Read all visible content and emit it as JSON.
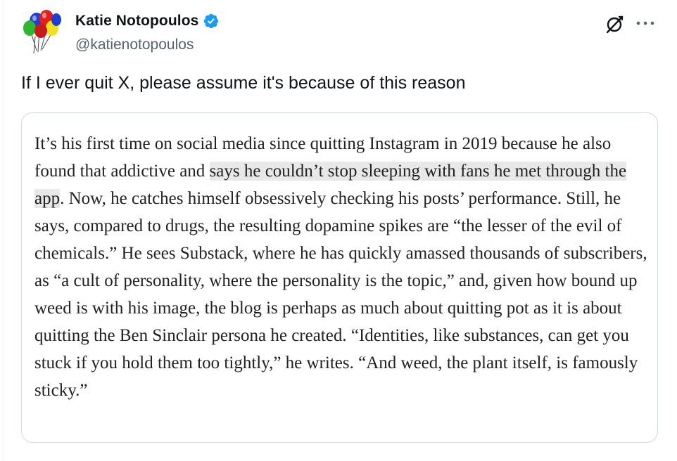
{
  "tweet": {
    "author": {
      "display_name": "Katie Notopoulos",
      "handle": "@katienotopoulos",
      "verified": true,
      "avatar_icon": "balloons-avatar-icon"
    },
    "text": "If I ever quit X, please assume it's because of this reason",
    "actions": {
      "grok_icon": "grok-icon",
      "more_icon": "more-options-icon"
    },
    "quoted_image": {
      "segments": [
        {
          "text": "It’s his first time on social media since quitting Instagram in 2019 because he also found that addictive and ",
          "highlight": false
        },
        {
          "text": "says he couldn’t stop sleeping with fans he met through the app",
          "highlight": true
        },
        {
          "text": ". Now, he catches himself obsessively checking his posts’ performance. Still, he says, compared to drugs, the resulting dopamine spikes are “the lesser of the evil of chemicals.” He sees Substack, where he has quickly amassed thousands of subscribers, as “a cult of personality, where the personality is the topic,” and, given how bound up weed is with his image, the blog is perhaps as much about quitting pot as it is about quitting the Ben Sinclair persona he created. “Identities, like substances, can get you stuck if you hold them too tightly,” he writes. “And weed, the plant itself, is famously sticky.”",
          "highlight": false
        }
      ],
      "highlight_color": "#e8e8e8"
    }
  },
  "colors": {
    "verified_blue": "#1d9bf0",
    "secondary_text": "#536471",
    "primary_text": "#0f1419",
    "border": "#cfd9de"
  }
}
